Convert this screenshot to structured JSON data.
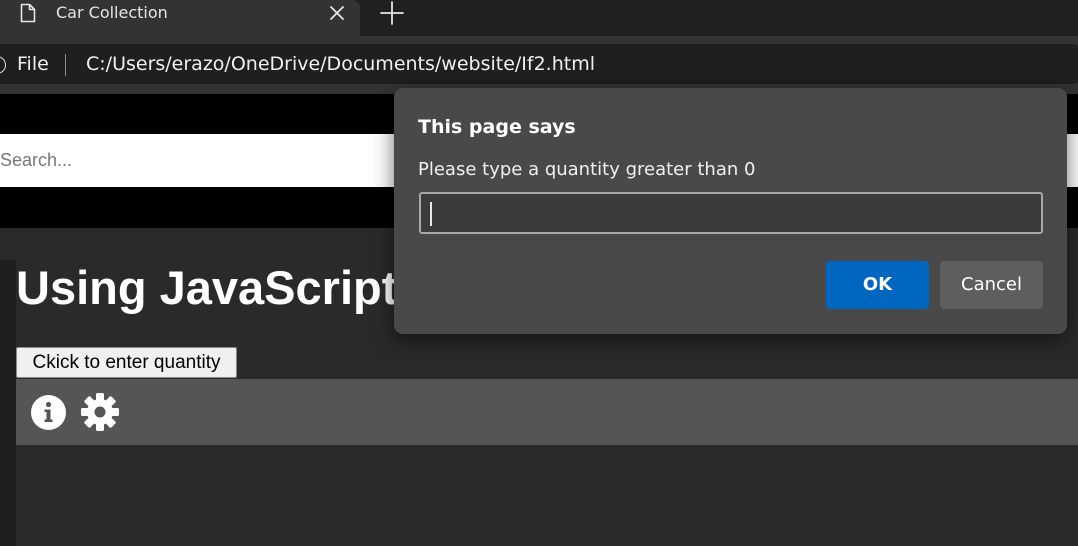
{
  "browser": {
    "tab": {
      "title": "Car Collection",
      "page_icon": "page-icon",
      "close_icon": "close-icon"
    },
    "new_tab_icon": "plus-icon",
    "address_bar": {
      "scheme_label": "File",
      "url": "C:/Users/erazo/OneDrive/Documents/website/If2.html",
      "info_icon": "info-icon"
    }
  },
  "page": {
    "search": {
      "placeholder": "Search..."
    },
    "heading": "Using JavaScript",
    "quantity_button_label": "Ckick to enter quantity",
    "icons": [
      "info-circle-icon",
      "gear-icon"
    ]
  },
  "dialog": {
    "title": "This page says",
    "message": "Please type a quantity greater than 0",
    "input_value": "",
    "ok_label": "OK",
    "cancel_label": "Cancel"
  },
  "colors": {
    "dialog_bg": "#494949",
    "ok_button": "#0067c0",
    "cancel_button": "#5e5e5e",
    "icon_bar": "#555555"
  }
}
